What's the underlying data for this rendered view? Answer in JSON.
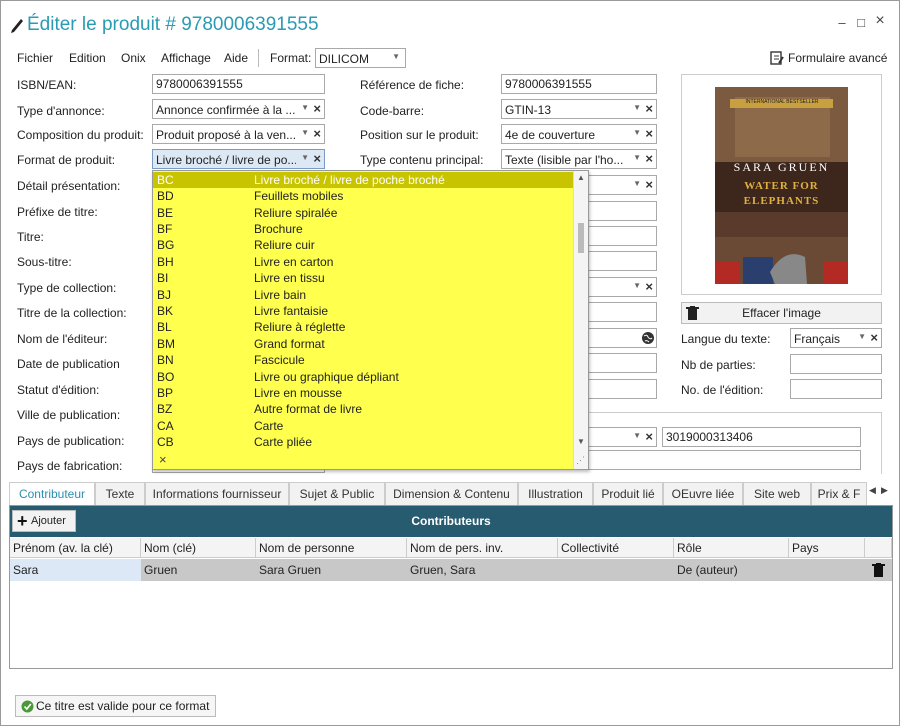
{
  "window": {
    "title": "Éditer le produit # 9780006391555",
    "minimize": "–",
    "maximize": "□",
    "close": "×"
  },
  "menu": {
    "items": [
      "Fichier",
      "Edition",
      "Onix",
      "Affichage",
      "Aide"
    ],
    "format_label": "Format:",
    "format_value": "DILICOM",
    "advanced": "Formulaire avancé"
  },
  "left_labels": [
    "ISBN/EAN:",
    "Type d'annonce:",
    "Composition du produit:",
    "Format de produit:",
    "Détail présentation:",
    "Préfixe de titre:",
    "Titre:",
    "Sous-titre:",
    "Type de collection:",
    "Titre de la collection:",
    "Nom de l'éditeur:",
    "Date de publication",
    "Statut d'édition:",
    "Ville de publication:",
    "Pays de publication:",
    "Pays de fabrication:"
  ],
  "left_values": {
    "isbn": "9780006391555",
    "type_annonce": "Annonce confirmée à la ...",
    "composition": "Produit proposé à la ven...",
    "format_produit": "Livre broché / livre de po..."
  },
  "mid_labels": [
    "Référence de fiche:",
    "Code-barre:",
    "Position sur le produit:",
    "Type contenu principal:"
  ],
  "mid_values": {
    "reference": "9780006391555",
    "code_barre": "GTIN-13",
    "position": "4e de couverture",
    "type_contenu": "Texte (lisible par l'ho..."
  },
  "right": {
    "clear_image": "Effacer l'image",
    "langue_label": "Langue du texte:",
    "langue_value": "Français",
    "nb_parties_label": "Nb de parties:",
    "edition_label": "No. de l'édition:",
    "gln": "3019000313406"
  },
  "cover": {
    "author": "SARA GRUEN",
    "title_line1": "WATER FOR",
    "title_line2": "ELEPHANTS",
    "banner": "INTERNATIONAL BESTSELLER"
  },
  "dropdown": {
    "options": [
      {
        "code": "BC",
        "name": "Livre broché / livre de poche broché"
      },
      {
        "code": "BD",
        "name": "Feuillets mobiles"
      },
      {
        "code": "BE",
        "name": "Reliure spiralée"
      },
      {
        "code": "BF",
        "name": "Brochure"
      },
      {
        "code": "BG",
        "name": "Reliure cuir"
      },
      {
        "code": "BH",
        "name": "Livre en carton"
      },
      {
        "code": "BI",
        "name": "Livre en tissu"
      },
      {
        "code": "BJ",
        "name": "Livre bain"
      },
      {
        "code": "BK",
        "name": "Livre fantaisie"
      },
      {
        "code": "BL",
        "name": "Reliure à réglette"
      },
      {
        "code": "BM",
        "name": "Grand format"
      },
      {
        "code": "BN",
        "name": "Fascicule"
      },
      {
        "code": "BO",
        "name": "Livre ou graphique dépliant"
      },
      {
        "code": "BP",
        "name": "Livre en mousse"
      },
      {
        "code": "BZ",
        "name": "Autre format de livre"
      },
      {
        "code": "CA",
        "name": "Carte"
      },
      {
        "code": "CB",
        "name": "Carte pliée"
      }
    ],
    "clear": "×"
  },
  "tabs": [
    "Contributeur",
    "Texte",
    "Informations fournisseur",
    "Sujet & Public",
    "Dimension & Contenu",
    "Illustration",
    "Produit lié",
    "OEuvre liée",
    "Site web",
    "Prix & F"
  ],
  "contributors": {
    "title": "Contributeurs",
    "add": "Ajouter",
    "columns": [
      "Prénom (av. la clé)",
      "Nom (clé)",
      "Nom de personne",
      "Nom de pers. inv.",
      "Collectivité",
      "Rôle",
      "Pays"
    ],
    "rows": [
      [
        "Sara",
        "Gruen",
        "Sara Gruen",
        "Gruen, Sara",
        "",
        "De (auteur)",
        ""
      ]
    ]
  },
  "status": "Ce titre est valide pour ce format"
}
